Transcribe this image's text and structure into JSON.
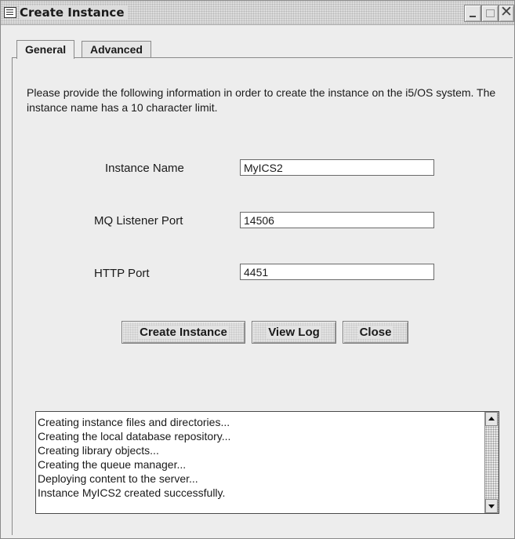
{
  "window": {
    "title": "Create Instance",
    "icon": "window-list-icon",
    "controls": {
      "minimize": "minimize-icon",
      "maximize": "maximize-icon",
      "close": "✕"
    }
  },
  "tabs": [
    {
      "label": "General",
      "active": true
    },
    {
      "label": "Advanced",
      "active": false
    }
  ],
  "intro_text": "Please provide the following information in order to create the instance on the i5/OS system. The instance name has a 10 character limit.",
  "form": {
    "instance_name": {
      "label": "Instance Name",
      "value": "MyICS2"
    },
    "mq_listener_port": {
      "label": "MQ Listener Port",
      "value": "14506"
    },
    "http_port": {
      "label": "HTTP Port",
      "value": "4451"
    }
  },
  "buttons": {
    "create_instance": "Create Instance",
    "view_log": "View Log",
    "close": "Close"
  },
  "log": {
    "lines": [
      "Creating instance files and directories...",
      "Creating the local database repository...",
      "Creating library objects...",
      "Creating the queue manager...",
      "Deploying content to the server...",
      "Instance MyICS2 created successfully."
    ]
  }
}
